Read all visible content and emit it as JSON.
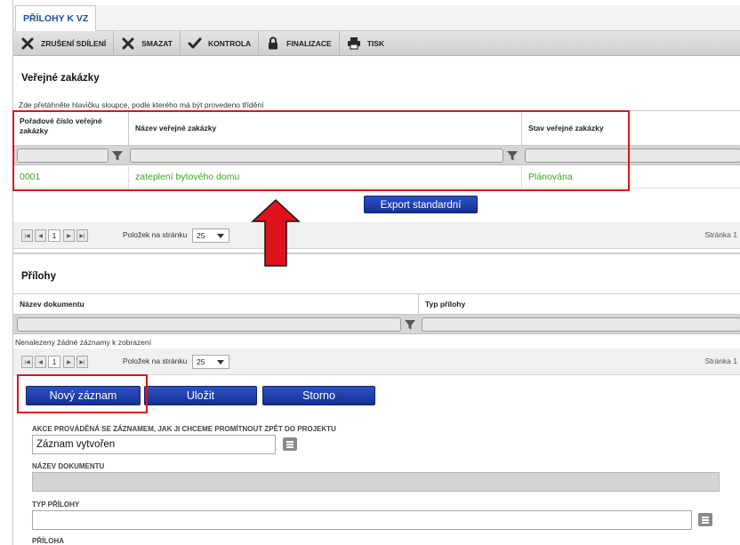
{
  "tab": {
    "label": "PŘÍLOHY K VZ"
  },
  "toolbar": {
    "items": [
      {
        "label": "ZRUŠENÍ SDÍLENÍ",
        "icon": "x-icon"
      },
      {
        "label": "SMAZAT",
        "icon": "x-icon"
      },
      {
        "label": "KONTROLA",
        "icon": "check-icon"
      },
      {
        "label": "FINALIZACE",
        "icon": "lock-icon"
      },
      {
        "label": "TISK",
        "icon": "printer-icon"
      }
    ]
  },
  "verejne": {
    "title": "Veřejné zakázky",
    "hint": "Zde přetáhněte hlavičku sloupce, podle kterého má být provedeno třídění",
    "columns": [
      "Pořadové číslo veřejné zakázky",
      "Název veřejné zakázky",
      "Stav veřejné zakázky"
    ],
    "rows": [
      {
        "cislo": "0001",
        "nazev": "zateplení bytového domu",
        "stav": "Plánována"
      }
    ],
    "export_label": "Export standardní",
    "pager": {
      "page": "1",
      "per_page_label": "Položek na stránku",
      "per_page": "25",
      "page_info": "Stránka 1"
    }
  },
  "prilohy": {
    "title": "Přílohy",
    "columns": [
      "Název dokumentu",
      "Typ přílohy"
    ],
    "empty": "Nenalezeny žádné záznamy k zobrazení",
    "pager": {
      "page": "1",
      "per_page_label": "Položek na stránku",
      "per_page": "25",
      "page_info": "Stránka 1"
    }
  },
  "buttons": {
    "new": "Nový záznam",
    "save": "Uložit",
    "cancel": "Storno"
  },
  "form": {
    "akce_label": "AKCE PROVÁDĚNÁ SE ZÁZNAMEM, JAK JI CHCEME PROMÍTNOUT ZPĚT DO PROJEKTU",
    "akce_value": "Záznam vytvořen",
    "nazev_label": "NÁZEV DOKUMENTU",
    "nazev_value": "",
    "typ_label": "TYP PŘÍLOHY",
    "typ_value": "",
    "priloha_label": "PŘÍLOHA"
  },
  "colors": {
    "accent": "#1d4e9a",
    "button": "#1f3fae",
    "green_text": "#3aa428",
    "highlight": "#e0121c"
  }
}
